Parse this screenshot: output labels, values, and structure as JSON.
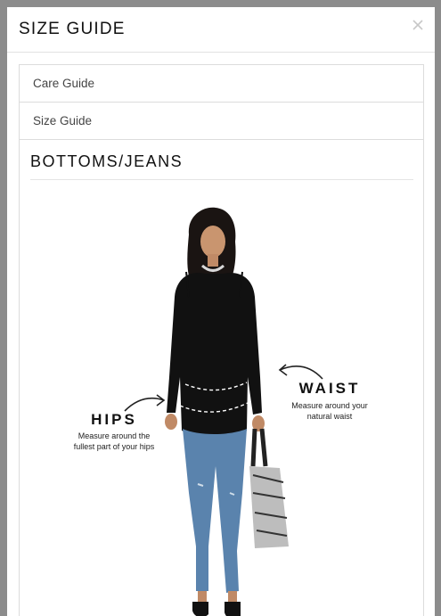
{
  "modal": {
    "title": "SIZE GUIDE",
    "close_icon": "close-icon"
  },
  "tabs": [
    {
      "label": "Care Guide"
    },
    {
      "label": "Size Guide"
    }
  ],
  "section": {
    "title": "BOTTOMS/JEANS"
  },
  "measurements": {
    "hips": {
      "title": "HIPS",
      "line1": "Measure around the",
      "line2": "fullest part of your hips"
    },
    "waist": {
      "title": "WAIST",
      "line1": "Measure around your",
      "line2": "natural waist"
    }
  },
  "colors": {
    "overlay": "#8c8c8c",
    "modal_bg": "#ffffff",
    "border": "#dcdcdc",
    "text": "#111111"
  }
}
